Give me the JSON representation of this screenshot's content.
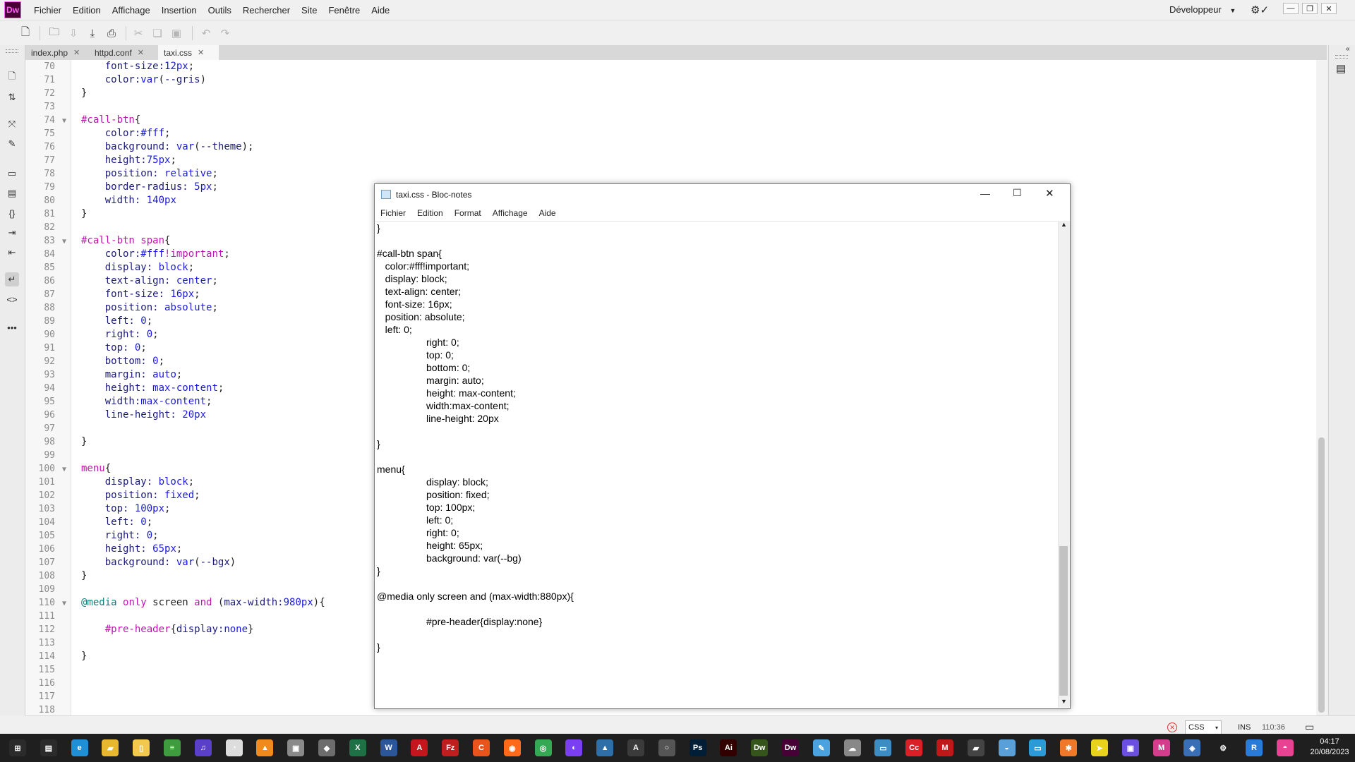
{
  "app": {
    "logo": "Dw",
    "menu": [
      "Fichier",
      "Edition",
      "Affichage",
      "Insertion",
      "Outils",
      "Rechercher",
      "Site",
      "Fenêtre",
      "Aide"
    ],
    "workspace": "Développeur",
    "accent": "#ff61f6"
  },
  "tabs": [
    {
      "label": "index.php",
      "active": false
    },
    {
      "label": "httpd.conf",
      "active": false
    },
    {
      "label": "taxi.css",
      "active": true
    }
  ],
  "editor": {
    "lines": [
      {
        "n": "70",
        "fold": false,
        "code": [
          {
            "t": "    "
          },
          {
            "c": "prop",
            "t": "font-size:"
          },
          {
            "c": "val",
            "t": "12px"
          },
          {
            "t": ";"
          }
        ]
      },
      {
        "n": "71",
        "fold": false,
        "code": [
          {
            "t": "    "
          },
          {
            "c": "prop",
            "t": "color:"
          },
          {
            "c": "val",
            "t": "var"
          },
          {
            "t": "("
          },
          {
            "c": "prop",
            "t": "--gris"
          },
          {
            "t": ")"
          }
        ]
      },
      {
        "n": "72",
        "fold": false,
        "code": [
          {
            "t": "}"
          }
        ]
      },
      {
        "n": "73",
        "fold": false,
        "code": []
      },
      {
        "n": "74",
        "fold": true,
        "code": [
          {
            "c": "sel",
            "t": "#call-btn"
          },
          {
            "t": "{"
          }
        ]
      },
      {
        "n": "75",
        "fold": false,
        "code": [
          {
            "t": "    "
          },
          {
            "c": "prop",
            "t": "color:"
          },
          {
            "c": "val",
            "t": "#fff"
          },
          {
            "t": ";"
          }
        ]
      },
      {
        "n": "76",
        "fold": false,
        "code": [
          {
            "t": "    "
          },
          {
            "c": "prop",
            "t": "background: "
          },
          {
            "c": "val",
            "t": "var"
          },
          {
            "t": "("
          },
          {
            "c": "prop",
            "t": "--theme"
          },
          {
            "t": ");"
          }
        ]
      },
      {
        "n": "77",
        "fold": false,
        "code": [
          {
            "t": "    "
          },
          {
            "c": "prop",
            "t": "height:"
          },
          {
            "c": "val",
            "t": "75px"
          },
          {
            "t": ";"
          }
        ]
      },
      {
        "n": "78",
        "fold": false,
        "code": [
          {
            "t": "    "
          },
          {
            "c": "prop",
            "t": "position: "
          },
          {
            "c": "val",
            "t": "relative"
          },
          {
            "t": ";"
          }
        ]
      },
      {
        "n": "79",
        "fold": false,
        "code": [
          {
            "t": "    "
          },
          {
            "c": "prop",
            "t": "border-radius: "
          },
          {
            "c": "val",
            "t": "5px"
          },
          {
            "t": ";"
          }
        ]
      },
      {
        "n": "80",
        "fold": false,
        "code": [
          {
            "t": "    "
          },
          {
            "c": "prop",
            "t": "width: "
          },
          {
            "c": "val",
            "t": "140px"
          }
        ]
      },
      {
        "n": "81",
        "fold": false,
        "code": [
          {
            "t": "}"
          }
        ]
      },
      {
        "n": "82",
        "fold": false,
        "code": []
      },
      {
        "n": "83",
        "fold": true,
        "code": [
          {
            "c": "sel",
            "t": "#call-btn span"
          },
          {
            "t": "{"
          }
        ]
      },
      {
        "n": "84",
        "fold": false,
        "code": [
          {
            "t": "    "
          },
          {
            "c": "prop",
            "t": "color:"
          },
          {
            "c": "val",
            "t": "#fff"
          },
          {
            "c": "kw",
            "t": "!important"
          },
          {
            "t": ";"
          }
        ]
      },
      {
        "n": "85",
        "fold": false,
        "code": [
          {
            "t": "    "
          },
          {
            "c": "prop",
            "t": "display: "
          },
          {
            "c": "val",
            "t": "block"
          },
          {
            "t": ";"
          }
        ]
      },
      {
        "n": "86",
        "fold": false,
        "code": [
          {
            "t": "    "
          },
          {
            "c": "prop",
            "t": "text-align: "
          },
          {
            "c": "val",
            "t": "center"
          },
          {
            "t": ";"
          }
        ]
      },
      {
        "n": "87",
        "fold": false,
        "code": [
          {
            "t": "    "
          },
          {
            "c": "prop",
            "t": "font-size: "
          },
          {
            "c": "val",
            "t": "16px"
          },
          {
            "t": ";"
          }
        ]
      },
      {
        "n": "88",
        "fold": false,
        "code": [
          {
            "t": "    "
          },
          {
            "c": "prop",
            "t": "position: "
          },
          {
            "c": "val",
            "t": "absolute"
          },
          {
            "t": ";"
          }
        ]
      },
      {
        "n": "89",
        "fold": false,
        "code": [
          {
            "t": "    "
          },
          {
            "c": "prop",
            "t": "left: "
          },
          {
            "c": "val",
            "t": "0"
          },
          {
            "t": ";"
          }
        ]
      },
      {
        "n": "90",
        "fold": false,
        "code": [
          {
            "t": "    "
          },
          {
            "c": "prop",
            "t": "right: "
          },
          {
            "c": "val",
            "t": "0"
          },
          {
            "t": ";"
          }
        ]
      },
      {
        "n": "91",
        "fold": false,
        "code": [
          {
            "t": "    "
          },
          {
            "c": "prop",
            "t": "top: "
          },
          {
            "c": "val",
            "t": "0"
          },
          {
            "t": ";"
          }
        ]
      },
      {
        "n": "92",
        "fold": false,
        "code": [
          {
            "t": "    "
          },
          {
            "c": "prop",
            "t": "bottom: "
          },
          {
            "c": "val",
            "t": "0"
          },
          {
            "t": ";"
          }
        ]
      },
      {
        "n": "93",
        "fold": false,
        "code": [
          {
            "t": "    "
          },
          {
            "c": "prop",
            "t": "margin: "
          },
          {
            "c": "val",
            "t": "auto"
          },
          {
            "t": ";"
          }
        ]
      },
      {
        "n": "94",
        "fold": false,
        "code": [
          {
            "t": "    "
          },
          {
            "c": "prop",
            "t": "height: "
          },
          {
            "c": "val",
            "t": "max-content"
          },
          {
            "t": ";"
          }
        ]
      },
      {
        "n": "95",
        "fold": false,
        "code": [
          {
            "t": "    "
          },
          {
            "c": "prop",
            "t": "width:"
          },
          {
            "c": "val",
            "t": "max-content"
          },
          {
            "t": ";"
          }
        ]
      },
      {
        "n": "96",
        "fold": false,
        "code": [
          {
            "t": "    "
          },
          {
            "c": "prop",
            "t": "line-height: "
          },
          {
            "c": "val",
            "t": "20px"
          }
        ]
      },
      {
        "n": "97",
        "fold": false,
        "code": []
      },
      {
        "n": "98",
        "fold": false,
        "code": [
          {
            "t": "}"
          }
        ]
      },
      {
        "n": "99",
        "fold": false,
        "code": []
      },
      {
        "n": "100",
        "fold": true,
        "code": [
          {
            "c": "sel",
            "t": "menu"
          },
          {
            "t": "{"
          }
        ]
      },
      {
        "n": "101",
        "fold": false,
        "code": [
          {
            "t": "    "
          },
          {
            "c": "prop",
            "t": "display: "
          },
          {
            "c": "val",
            "t": "block"
          },
          {
            "t": ";"
          }
        ]
      },
      {
        "n": "102",
        "fold": false,
        "code": [
          {
            "t": "    "
          },
          {
            "c": "prop",
            "t": "position: "
          },
          {
            "c": "val",
            "t": "fixed"
          },
          {
            "t": ";"
          }
        ]
      },
      {
        "n": "103",
        "fold": false,
        "code": [
          {
            "t": "    "
          },
          {
            "c": "prop",
            "t": "top: "
          },
          {
            "c": "val",
            "t": "100px"
          },
          {
            "t": ";"
          }
        ]
      },
      {
        "n": "104",
        "fold": false,
        "code": [
          {
            "t": "    "
          },
          {
            "c": "prop",
            "t": "left: "
          },
          {
            "c": "val",
            "t": "0"
          },
          {
            "t": ";"
          }
        ]
      },
      {
        "n": "105",
        "fold": false,
        "code": [
          {
            "t": "    "
          },
          {
            "c": "prop",
            "t": "right: "
          },
          {
            "c": "val",
            "t": "0"
          },
          {
            "t": ";"
          }
        ]
      },
      {
        "n": "106",
        "fold": false,
        "code": [
          {
            "t": "    "
          },
          {
            "c": "prop",
            "t": "height: "
          },
          {
            "c": "val",
            "t": "65px"
          },
          {
            "t": ";"
          }
        ]
      },
      {
        "n": "107",
        "fold": false,
        "code": [
          {
            "t": "    "
          },
          {
            "c": "prop",
            "t": "background: "
          },
          {
            "c": "val",
            "t": "var"
          },
          {
            "t": "("
          },
          {
            "c": "prop",
            "t": "--bgx"
          },
          {
            "t": ")"
          }
        ]
      },
      {
        "n": "108",
        "fold": false,
        "code": [
          {
            "t": "}"
          }
        ]
      },
      {
        "n": "109",
        "fold": false,
        "code": []
      },
      {
        "n": "110",
        "fold": true,
        "code": [
          {
            "c": "at",
            "t": "@media"
          },
          {
            "t": " "
          },
          {
            "c": "kw",
            "t": "only"
          },
          {
            "t": " screen "
          },
          {
            "c": "kw",
            "t": "and"
          },
          {
            "t": " ("
          },
          {
            "c": "prop",
            "t": "max-width:"
          },
          {
            "c": "val",
            "t": "980px"
          },
          {
            "t": "){"
          }
        ]
      },
      {
        "n": "111",
        "fold": false,
        "code": []
      },
      {
        "n": "112",
        "fold": false,
        "code": [
          {
            "t": "    "
          },
          {
            "c": "sel",
            "t": "#pre-header"
          },
          {
            "t": "{"
          },
          {
            "c": "prop",
            "t": "display:"
          },
          {
            "c": "val",
            "t": "none"
          },
          {
            "t": "}"
          }
        ]
      },
      {
        "n": "113",
        "fold": false,
        "code": []
      },
      {
        "n": "114",
        "fold": false,
        "code": [
          {
            "t": "}"
          }
        ]
      },
      {
        "n": "115",
        "fold": false,
        "code": []
      },
      {
        "n": "116",
        "fold": false,
        "code": []
      },
      {
        "n": "117",
        "fold": false,
        "code": []
      },
      {
        "n": "118",
        "fold": false,
        "code": []
      }
    ]
  },
  "status": {
    "language": "CSS",
    "mode": "INS",
    "position": "110:36"
  },
  "notepad": {
    "title": "taxi.css - Bloc-notes",
    "menu": [
      "Fichier",
      "Edition",
      "Format",
      "Affichage",
      "Aide"
    ],
    "lines": [
      "}",
      "",
      "#call-btn span{",
      "   color:#fff!important;",
      "   display: block;",
      "   text-align: center;",
      "   font-size: 16px;",
      "   position: absolute;",
      "   left: 0;",
      "                  right: 0;",
      "                  top: 0;",
      "                  bottom: 0;",
      "                  margin: auto;",
      "                  height: max-content;",
      "                  width:max-content;",
      "                  line-height: 20px",
      "",
      "}",
      "",
      "menu{",
      "                  display: block;",
      "                  position: fixed;",
      "                  top: 100px;",
      "                  left: 0;",
      "                  right: 0;",
      "                  height: 65px;",
      "                  background: var(--bg)",
      "}",
      "",
      "@media only screen and (max-width:880px){",
      "",
      "                  #pre-header{display:none}",
      "",
      "}"
    ]
  },
  "taskbar": {
    "time": "04:17",
    "date": "20/08/2023",
    "icons": [
      {
        "name": "start-icon",
        "label": "⊞",
        "color": "#2b2b2b"
      },
      {
        "name": "task-view-icon",
        "label": "▤",
        "color": "#2b2b2b"
      },
      {
        "name": "edge-icon",
        "label": "e",
        "color": "#1f8fd6"
      },
      {
        "name": "file-explorer-icon",
        "label": "▰",
        "color": "#e8b730"
      },
      {
        "name": "notepad-file-icon",
        "label": "▯",
        "color": "#f2c94c"
      },
      {
        "name": "stack-icon",
        "label": "≡",
        "color": "#3e9b3e"
      },
      {
        "name": "music-icon",
        "label": "♫",
        "color": "#5a3fc9"
      },
      {
        "name": "clock-app-icon",
        "label": "◔",
        "color": "#dddddd"
      },
      {
        "name": "vlc-icon",
        "label": "▲",
        "color": "#f08a1c"
      },
      {
        "name": "app-gray-icon",
        "label": "▣",
        "color": "#8a8a8a"
      },
      {
        "name": "package-icon",
        "label": "◆",
        "color": "#6d6d6d"
      },
      {
        "name": "excel-icon",
        "label": "X",
        "color": "#1e7145"
      },
      {
        "name": "word-icon",
        "label": "W",
        "color": "#2b579a"
      },
      {
        "name": "acrobat-icon",
        "label": "A",
        "color": "#c4161c"
      },
      {
        "name": "filezilla-icon",
        "label": "Fz",
        "color": "#bf1e1e"
      },
      {
        "name": "ccleaner-icon",
        "label": "C",
        "color": "#e8541c"
      },
      {
        "name": "firefox-icon",
        "label": "◉",
        "color": "#ff6a1a"
      },
      {
        "name": "chrome-icon",
        "label": "◎",
        "color": "#34a853"
      },
      {
        "name": "podcast-icon",
        "label": "◐",
        "color": "#7a3ff0"
      },
      {
        "name": "photo-icon",
        "label": "▲",
        "color": "#2d6fa6"
      },
      {
        "name": "arc-icon",
        "label": "A",
        "color": "#3b3b3b"
      },
      {
        "name": "disk-icon",
        "label": "○",
        "color": "#555555"
      },
      {
        "name": "photoshop-icon",
        "label": "Ps",
        "color": "#001e36"
      },
      {
        "name": "illustrator-icon",
        "label": "Ai",
        "color": "#330000"
      },
      {
        "name": "dreamweaver-old-icon",
        "label": "Dw",
        "color": "#35551b"
      },
      {
        "name": "dreamweaver-icon",
        "label": "Dw",
        "color": "#470137"
      },
      {
        "name": "notepad-icon",
        "label": "✎",
        "color": "#4aa3df"
      },
      {
        "name": "network-icon",
        "label": "☁",
        "color": "#888888"
      },
      {
        "name": "remote-icon",
        "label": "▭",
        "color": "#3c8dc4"
      },
      {
        "name": "creative-cloud-icon",
        "label": "Cc",
        "color": "#da1f26"
      },
      {
        "name": "mcafee-icon",
        "label": "M",
        "color": "#c01818"
      },
      {
        "name": "folder-dark-icon",
        "label": "▰",
        "color": "#444444"
      },
      {
        "name": "cloud-sync-icon",
        "label": "◒",
        "color": "#5aa0d8"
      },
      {
        "name": "monitor-icon",
        "label": "▭",
        "color": "#2a9bd8"
      },
      {
        "name": "star-app-icon",
        "label": "✱",
        "color": "#f0782a"
      },
      {
        "name": "arrow-app-icon",
        "label": "➤",
        "color": "#e8d21c"
      },
      {
        "name": "media-icon",
        "label": "▣",
        "color": "#6a4fe0"
      },
      {
        "name": "mail-icon",
        "label": "M",
        "color": "#d43c8c"
      },
      {
        "name": "security-icon",
        "label": "◈",
        "color": "#3a6fb5"
      },
      {
        "name": "settings-icon",
        "label": "⚙",
        "color": "#1f1f1f"
      },
      {
        "name": "remote-desktop-icon",
        "label": "R",
        "color": "#2a7ad8"
      },
      {
        "name": "gradient-app-icon",
        "label": "◓",
        "color": "#e84393"
      }
    ]
  }
}
